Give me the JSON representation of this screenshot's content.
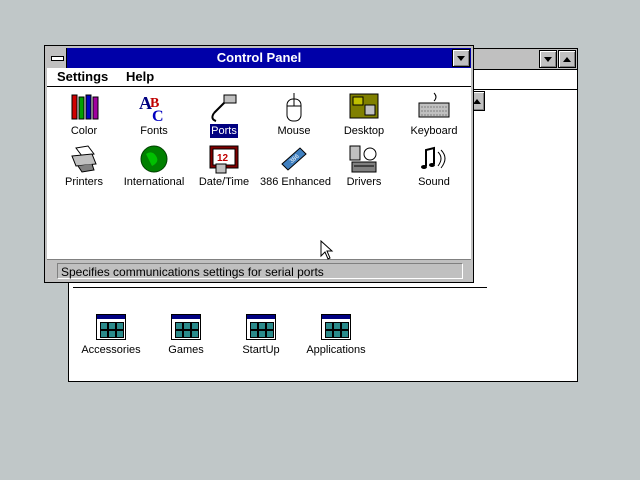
{
  "control_panel": {
    "title": "Control Panel",
    "menu": [
      "Settings",
      "Help"
    ],
    "icons": [
      {
        "label": "Color",
        "icon": "color-icon"
      },
      {
        "label": "Fonts",
        "icon": "fonts-icon"
      },
      {
        "label": "Ports",
        "icon": "ports-icon",
        "selected": true
      },
      {
        "label": "Mouse",
        "icon": "mouse-icon"
      },
      {
        "label": "Desktop",
        "icon": "desktop-icon"
      },
      {
        "label": "Keyboard",
        "icon": "keyboard-icon"
      },
      {
        "label": "Printers",
        "icon": "printers-icon"
      },
      {
        "label": "International",
        "icon": "international-icon"
      },
      {
        "label": "Date/Time",
        "icon": "date-time-icon"
      },
      {
        "label": "386 Enhanced",
        "icon": "386-enhanced-icon"
      },
      {
        "label": "Drivers",
        "icon": "drivers-icon"
      },
      {
        "label": "Sound",
        "icon": "sound-icon"
      }
    ],
    "status": "Specifies communications settings for serial ports"
  },
  "program_manager": {
    "groups": [
      "Accessories",
      "Games",
      "StartUp",
      "Applications"
    ]
  },
  "colors": {
    "active_title": "#0000a8",
    "desktop": "#c0c7c8",
    "selection": "#000080"
  }
}
